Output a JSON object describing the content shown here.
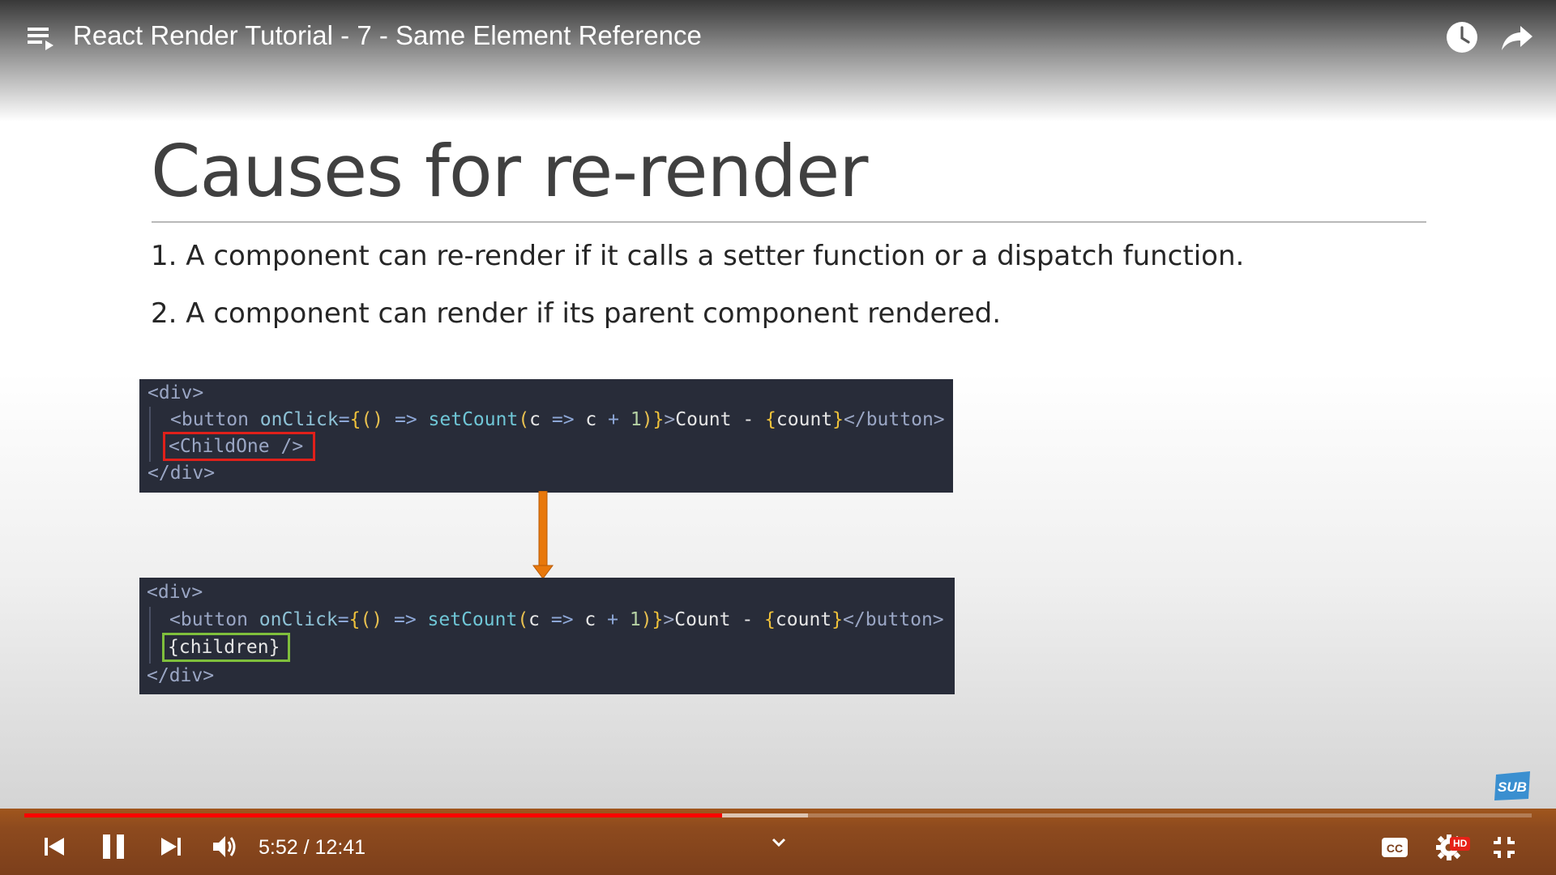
{
  "player": {
    "title": "React Render Tutorial - 7 - Same Element Reference",
    "current_time": "5:52",
    "duration": "12:41",
    "time_separator": " / ",
    "progress_fraction": 0.463,
    "buffered_fraction": 0.52,
    "quality_badge": "HD",
    "sub_badge": "SUB",
    "colors": {
      "accent": "#ff0000",
      "control_bar": "#8d4a1e",
      "badge": "#3a8fd0"
    },
    "icons": {
      "top_left": "playlist-icon",
      "top_right": [
        "watch-later-icon",
        "share-icon"
      ],
      "bottom_left": [
        "previous-icon",
        "pause-icon",
        "next-icon",
        "volume-icon"
      ],
      "bottom_center": "chevron-down-icon",
      "bottom_right": [
        "captions-icon",
        "settings-icon",
        "exit-fullscreen-icon"
      ]
    }
  },
  "slide": {
    "heading": "Causes for re-render",
    "points": [
      "1. A component can re-render if it calls a setter function or a dispatch function.",
      "2. A component can render if its parent component rendered."
    ],
    "code_before": {
      "open_div": "<div>",
      "button_tag_open": "<button ",
      "button_attr": "onClick",
      "button_eq": "=",
      "brace_open": "{",
      "paren_pair": "()",
      "arrow": " => ",
      "setter": "setCount",
      "paren_open": "(",
      "param": "c",
      "arrow2": " => ",
      "expr": "c",
      "plus": " + ",
      "one": "1",
      "paren_close": ")",
      "brace_close": "}",
      "gt": ">",
      "button_text": "Count - ",
      "count_open": "{",
      "count_var": "count",
      "count_close": "}",
      "button_close": "</button>",
      "highlight": "<ChildOne />",
      "close_div": "</div>"
    },
    "code_after": {
      "open_div": "<div>",
      "button_tag_open": "<button ",
      "button_attr": "onClick",
      "button_eq": "=",
      "brace_open": "{",
      "paren_pair": "()",
      "arrow": " => ",
      "setter": "setCount",
      "paren_open": "(",
      "param": "c",
      "arrow2": " => ",
      "expr": "c",
      "plus": " + ",
      "one": "1",
      "paren_close": ")",
      "brace_close": "}",
      "gt": ">",
      "button_text": "Count - ",
      "count_open": "{",
      "count_var": "count",
      "count_close": "}",
      "button_close": "</button>",
      "highlight": "{children}",
      "close_div": "</div>"
    },
    "highlight_colors": {
      "before": "#e0201a",
      "after": "#7fbf3c",
      "arrow": "#e8780c"
    }
  }
}
